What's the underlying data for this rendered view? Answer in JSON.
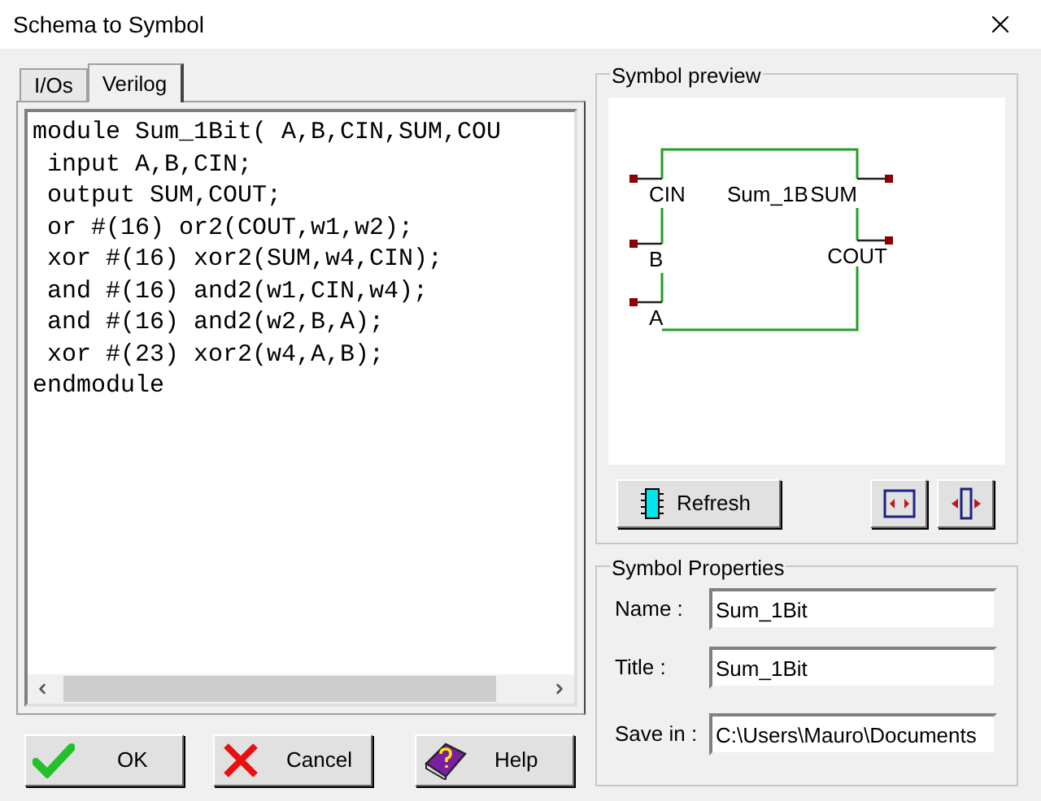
{
  "window": {
    "title": "Schema to Symbol"
  },
  "tabs": [
    {
      "label": "I/Os",
      "selected": false
    },
    {
      "label": "Verilog",
      "selected": true
    }
  ],
  "code_lines": [
    "module Sum_1Bit( A,B,CIN,SUM,COU",
    " input A,B,CIN;",
    " output SUM,COUT;",
    " or #(16) or2(COUT,w1,w2);",
    " xor #(16) xor2(SUM,w4,CIN);",
    " and #(16) and2(w1,CIN,w4);",
    " and #(16) and2(w2,B,A);",
    " xor #(23) xor2(w4,A,B);",
    "endmodule"
  ],
  "symbol_preview": {
    "title": "Symbol preview",
    "symbol_name": "Sum_1B",
    "left_pins": [
      "CIN",
      "B",
      "A"
    ],
    "right_pins": [
      "SUM",
      "COUT"
    ],
    "refresh_button": "Refresh"
  },
  "symbol_properties": {
    "title": "Symbol Properties",
    "fields": [
      {
        "label": "Name :",
        "value": "Sum_1Bit"
      },
      {
        "label": "Title :",
        "value": "Sum_1Bit"
      },
      {
        "label": "Save in :",
        "value": "C:\\Users\\Mauro\\Documents"
      }
    ]
  },
  "buttons": [
    {
      "kind": "ok",
      "label": "OK"
    },
    {
      "kind": "cancel",
      "label": "Cancel"
    },
    {
      "kind": "help",
      "label": "Help"
    }
  ]
}
